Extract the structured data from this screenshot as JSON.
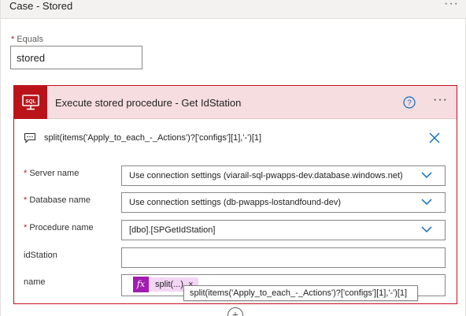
{
  "case_header": {
    "title": "Case - Stored",
    "more": "···"
  },
  "equals": {
    "required_marker": "*",
    "label": "Equals",
    "value": "stored"
  },
  "action": {
    "icon_name": "sql-server-icon",
    "icon_text": "SQL",
    "title": "Execute stored procedure - Get IdStation",
    "help": "?",
    "more": "···",
    "header_color": "#f6dde0",
    "border_color": "#c50f1f"
  },
  "expression": {
    "text": "split(items('Apply_to_each_-_Actions')?['configs'][1],'-')[1]"
  },
  "fields": {
    "server": {
      "required_marker": "*",
      "label": "Server name",
      "value": "Use connection settings (viarail-sql-pwapps-dev.database.windows.net)"
    },
    "database": {
      "required_marker": "*",
      "label": "Database name",
      "value": "Use connection settings (db-pwapps-lostandfound-dev)"
    },
    "procedure": {
      "required_marker": "*",
      "label": "Procedure name",
      "value": "[dbo].[SPGetIdStation]"
    },
    "idstation": {
      "label": "idStation",
      "value": ""
    },
    "name": {
      "label": "name",
      "token_fx": "fx",
      "token_text": "split(...)",
      "token_remove": "×"
    }
  },
  "tooltip": {
    "text": "split(items('Apply_to_each_-_Actions')?['configs'][1],'-')[1]"
  },
  "add_step": {
    "symbol": "+"
  }
}
